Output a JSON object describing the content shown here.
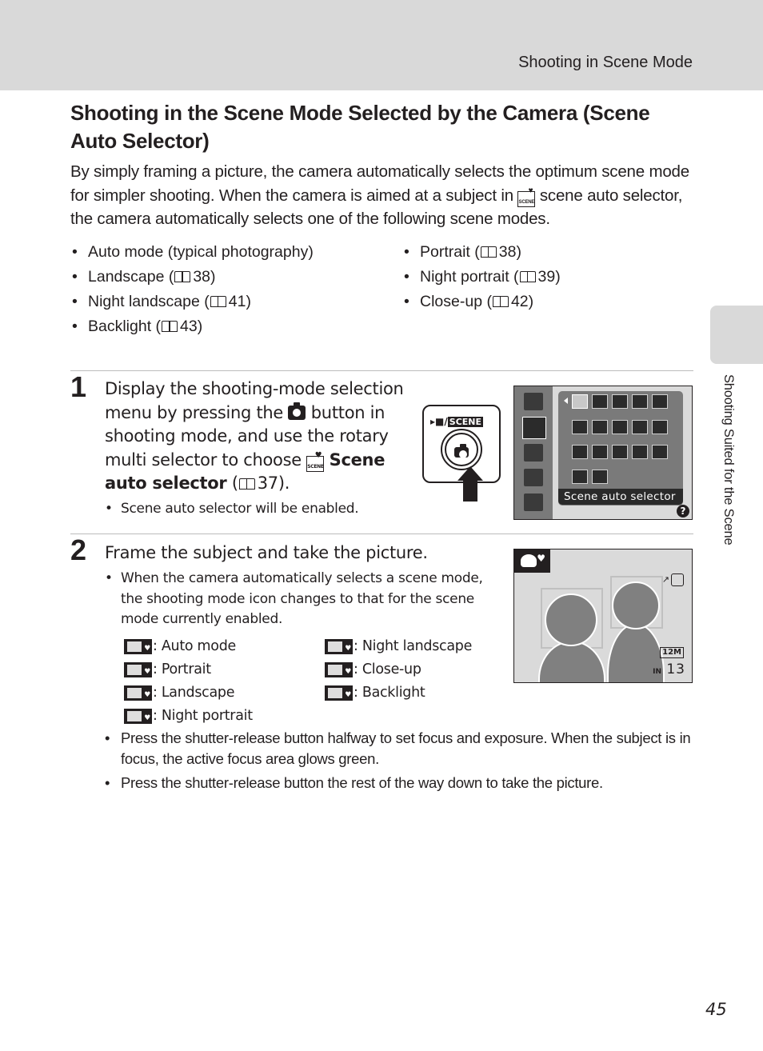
{
  "header": {
    "section": "Shooting in Scene Mode"
  },
  "title": "Shooting in the Scene Mode Selected by the Camera (Scene Auto Selector)",
  "intro": {
    "part1": "By simply framing a picture, the camera automatically selects the optimum scene mode for simpler shooting. When the camera is aimed at a subject in ",
    "icon": "scene-auto-selector-icon",
    "icon_text": "SCENE",
    "part2": " scene auto selector, the camera automatically selects one of the following scene modes."
  },
  "scene_modes": {
    "col1": [
      {
        "label": "Auto mode (typical photography)",
        "page": ""
      },
      {
        "label": "Landscape (",
        "page": "38)"
      },
      {
        "label": "Night landscape (",
        "page": "41)"
      },
      {
        "label": "Backlight (",
        "page": "43)"
      }
    ],
    "col2": [
      {
        "label": "Portrait (",
        "page": "38)"
      },
      {
        "label": "Night portrait (",
        "page": "39)"
      },
      {
        "label": "Close-up (",
        "page": "42)"
      }
    ]
  },
  "step1": {
    "number": "1",
    "text_a": "Display the shooting-mode selection menu by pressing the ",
    "text_b": " button in shooting mode, and use the rotary multi selector to choose ",
    "bold": "Scene auto selector",
    "ref_open": " (",
    "ref_page": "37).",
    "note": "Scene auto selector will be enabled.",
    "button_label_a": "/",
    "button_label_b": "SCENE",
    "screen_caption": "Scene auto selector",
    "screen_help": "?"
  },
  "step2": {
    "number": "2",
    "title": "Frame the subject and take the picture.",
    "note": "When the camera automatically selects a scene mode, the shooting mode icon changes to that for the scene mode currently enabled.",
    "modes_col1": [
      {
        "icon": "auto-mode-icon",
        "label": ": Auto mode"
      },
      {
        "icon": "portrait-icon",
        "label": ": Portrait"
      },
      {
        "icon": "landscape-icon",
        "label": ": Landscape"
      },
      {
        "icon": "night-portrait-icon",
        "label": ": Night portrait"
      }
    ],
    "modes_col2": [
      {
        "icon": "night-landscape-icon",
        "label": ": Night landscape"
      },
      {
        "icon": "close-up-icon",
        "label": ": Close-up"
      },
      {
        "icon": "backlight-icon",
        "label": ": Backlight"
      }
    ],
    "screen": {
      "image_size": "12M",
      "memory": "IN",
      "remaining": "13"
    },
    "bullets": [
      "Press the shutter-release button halfway to set focus and exposure. When the subject is in focus, the active focus area glows green.",
      "Press the shutter-release button the rest of the way down to take the picture."
    ]
  },
  "side_tab": {
    "text": "Shooting Suited for the Scene"
  },
  "page_number": "45"
}
